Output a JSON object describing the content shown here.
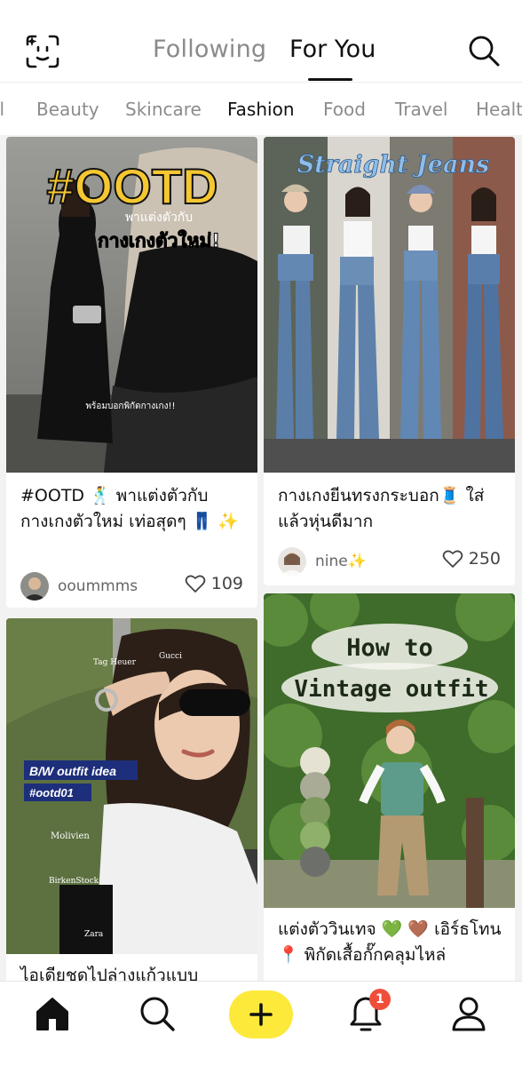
{
  "header": {
    "tab_following": "Following",
    "tab_for_you": "For You",
    "scan_icon": "face-scan-icon",
    "search_icon": "search-icon"
  },
  "categories": [
    "ll",
    "Beauty",
    "Skincare",
    "Fashion",
    "Food",
    "Travel",
    "Healt"
  ],
  "active_category": "Fashion",
  "posts": [
    {
      "image_text_1": "#OOTD",
      "image_text_2": "พาแต่งตัวกับ",
      "image_text_3": "กางเกงตัวใหม่!",
      "image_text_4": "พร้อมบอกพิกัดกางเกง!!",
      "title": "#OOTD 🕺 พาแต่งตัวกับ กางเกงตัวใหม่ เท่อสุดๆ 👖 ✨",
      "author": "ooummms",
      "likes": "109"
    },
    {
      "image_text_1": "Straight Jeans",
      "title": "กางเกงยีนทรงกระบอก🧵 ใส่แล้วหุ่นดีมาก",
      "author": "nine✨",
      "likes": "250"
    },
    {
      "image_text_1": "B/W outfit idea",
      "image_text_2": "#ootd01",
      "tags": [
        "Tag Heuer",
        "Gucci",
        "Molivien",
        "BirkenStock",
        "Zara"
      ],
      "title": "ไอเดียชุดไปล่างแก้วแบบ"
    },
    {
      "image_text_1": "How to",
      "image_text_2": "Vintage outfit",
      "title": "แต่งตัววินเทจ 💚 🤎 เอิร์ธโทน 📍 พิกัดเสื้อกั๊กคลุมไหล่"
    }
  ],
  "palette": [
    "#e6e2d3",
    "#a9ab97",
    "#7f9a5f",
    "#8fb06a",
    "#6d6f6b"
  ],
  "bottom_nav": {
    "home_icon": "home-icon",
    "search_icon": "search-icon",
    "add_icon": "plus-icon",
    "notification_icon": "bell-icon",
    "notification_count": "1",
    "profile_icon": "person-icon"
  },
  "colors": {
    "accent_yellow": "#fde93a",
    "badge_red": "#ef4e3b"
  }
}
